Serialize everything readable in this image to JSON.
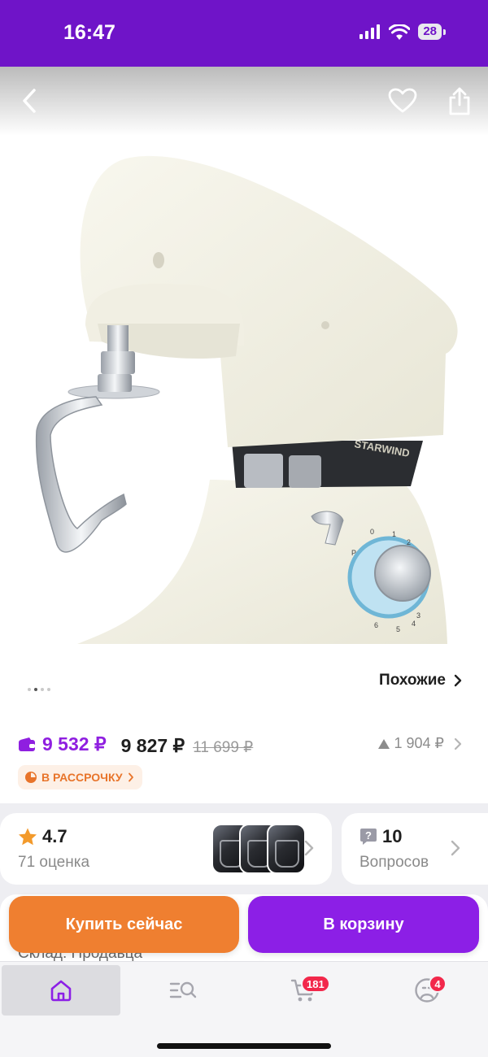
{
  "status_bar": {
    "time": "16:47",
    "battery": "28"
  },
  "gallery": {
    "brand_label": "STARWIND",
    "dial_numbers": [
      "0",
      "1",
      "2",
      "3",
      "4",
      "5",
      "6",
      "P"
    ],
    "page_count": 4,
    "active_page": 2
  },
  "similar": {
    "label": "Похожие"
  },
  "price": {
    "wallet_price": "9 532 ₽",
    "price": "9 827 ₽",
    "old_price": "11 699 ₽",
    "discount_amount": "1 904 ₽",
    "installment_label": "В РАССРОЧКУ"
  },
  "rating": {
    "value": "4.7",
    "count_label": "71 оценка"
  },
  "questions": {
    "value": "10",
    "label": "Вопросов"
  },
  "warehouse": {
    "label": "Склад: Продавца"
  },
  "actions": {
    "buy_now": "Купить сейчас",
    "add_to_cart": "В корзину"
  },
  "tab_bar": {
    "cart_badge": "181",
    "profile_badge": "4"
  },
  "colors": {
    "brand_purple": "#6f14c8",
    "buy_orange": "#ef7f30",
    "cart_purple": "#8c1fe6",
    "badge_red": "#f2284b"
  }
}
